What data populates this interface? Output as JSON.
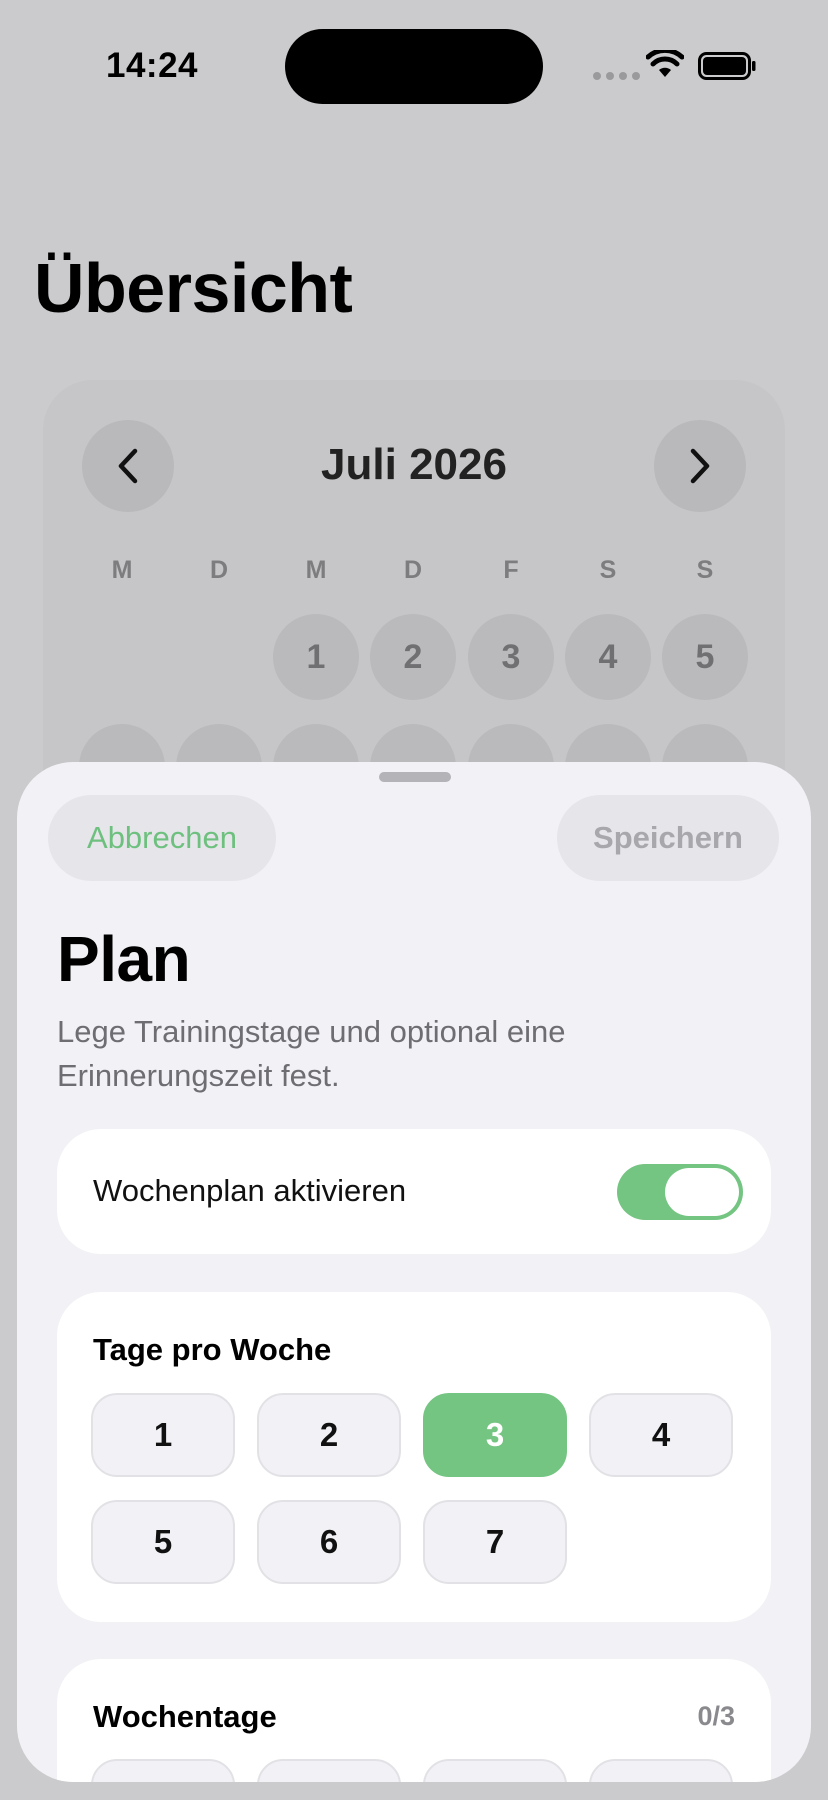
{
  "status": {
    "time": "14:24"
  },
  "page": {
    "title": "Übersicht"
  },
  "calendar": {
    "month": "Juli 2026",
    "weekdays": [
      "M",
      "D",
      "M",
      "D",
      "F",
      "S",
      "S"
    ],
    "first_week": [
      "1",
      "2",
      "3",
      "4",
      "5"
    ]
  },
  "sheet": {
    "cancel": "Abbrechen",
    "save": "Speichern",
    "title": "Plan",
    "subtitle": "Lege Trainingstage und optional eine Erinnerungszeit fest.",
    "plan_toggle": {
      "label": "Wochenplan aktivieren",
      "enabled": true
    },
    "days_per_week": {
      "title": "Tage pro Woche",
      "options": [
        "1",
        "2",
        "3",
        "4",
        "5",
        "6",
        "7"
      ],
      "selected": "3"
    },
    "weekdays_section": {
      "title": "Wochentage",
      "count": "0/3"
    }
  },
  "colors": {
    "accent": "#74c482",
    "sheet_bg": "#f2f2f6",
    "dim_bg": "#cbcbcd"
  }
}
